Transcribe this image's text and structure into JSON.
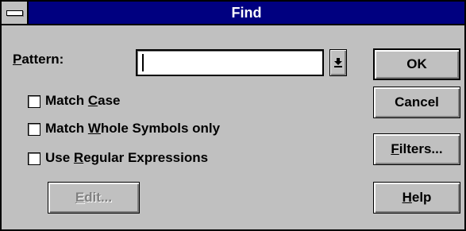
{
  "window": {
    "title": "Find"
  },
  "pattern": {
    "label": "Pattern:",
    "label_access_key": "P",
    "label_rest": "attern:",
    "value": ""
  },
  "options": [
    {
      "label": "Match Case",
      "pre": "Match ",
      "key": "C",
      "post": "ase",
      "checked": false
    },
    {
      "label": "Match Whole Symbols only",
      "pre": "Match ",
      "key": "W",
      "post": "hole Symbols only",
      "checked": false
    },
    {
      "label": "Use Regular Expressions",
      "pre": "Use ",
      "key": "R",
      "post": "egular Expressions",
      "checked": false
    }
  ],
  "buttons": {
    "ok": "OK",
    "cancel": "Cancel",
    "filters": {
      "key": "F",
      "rest": "ilters..."
    },
    "help": {
      "key": "H",
      "rest": "elp"
    },
    "edit": {
      "label": "Edit...",
      "key": "E",
      "rest": "dit...",
      "disabled": true
    }
  },
  "colors": {
    "face": "#c0c0c0",
    "titlebar": "#000080",
    "title_text": "#ffffff",
    "disabled_text": "#808080"
  }
}
